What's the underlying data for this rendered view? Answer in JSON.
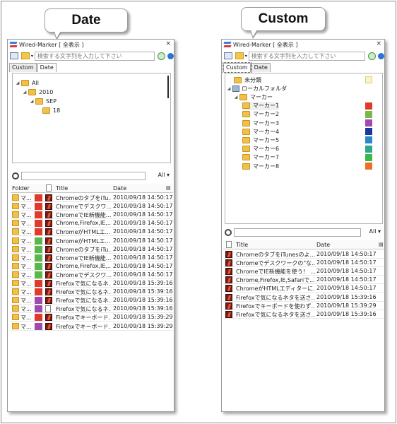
{
  "callouts": {
    "left": "Date",
    "right": "Custom"
  },
  "left_panel": {
    "title": "Wired-Marker [ 全表示 ]",
    "close": "×",
    "search_placeholder": "検索する文字列を入力して下さい",
    "tabs": [
      "Custom",
      "Date"
    ],
    "active_tab": "Date",
    "tree": [
      {
        "label": "All",
        "expanded": true
      },
      {
        "label": "2010",
        "expanded": true
      },
      {
        "label": "SEP",
        "expanded": true
      },
      {
        "label": "18",
        "expanded": false
      }
    ],
    "filter_all": "All",
    "columns": {
      "folder": "Folder",
      "title": "Title",
      "date": "Date"
    },
    "rows": [
      {
        "folder": "マ...",
        "color": "#e03a2a",
        "icon": "firefox",
        "title": "ChromeのタブをiTu...",
        "date": "2010/09/18 14:50:17"
      },
      {
        "folder": "マ...",
        "color": "#e03a2a",
        "icon": "firefox",
        "title": "Chromeでデスクワ...",
        "date": "2010/09/18 14:50:17"
      },
      {
        "folder": "マ...",
        "color": "#e03a2a",
        "icon": "firefox",
        "title": "ChromeでIE新機能...",
        "date": "2010/09/18 14:50:17"
      },
      {
        "folder": "マ...",
        "color": "#e03a2a",
        "icon": "firefox",
        "title": "Chrome,Firefox,IE,...",
        "date": "2010/09/18 14:50:17"
      },
      {
        "folder": "マ...",
        "color": "#e03a2a",
        "icon": "firefox",
        "title": "ChromeがHTMLエ...",
        "date": "2010/09/18 14:50:17"
      },
      {
        "folder": "マ...",
        "color": "#5ab84a",
        "icon": "firefox",
        "title": "ChromeがHTMLエ...",
        "date": "2010/09/18 14:50:17"
      },
      {
        "folder": "マ...",
        "color": "#5ab84a",
        "icon": "firefox",
        "title": "ChromeのタブをiTu...",
        "date": "2010/09/18 14:50:17"
      },
      {
        "folder": "マ...",
        "color": "#5ab84a",
        "icon": "firefox",
        "title": "ChromeでIE新機能...",
        "date": "2010/09/18 14:50:17"
      },
      {
        "folder": "マ...",
        "color": "#5ab84a",
        "icon": "firefox",
        "title": "Chrome,Firefox,IE,...",
        "date": "2010/09/18 14:50:17"
      },
      {
        "folder": "マ...",
        "color": "#5ab84a",
        "icon": "firefox",
        "title": "Chromeでデスクワ...",
        "date": "2010/09/18 14:50:17"
      },
      {
        "folder": "マ...",
        "color": "#e03a2a",
        "icon": "firefox",
        "title": "Firefoxで気になるネ...",
        "date": "2010/09/18 15:39:16"
      },
      {
        "folder": "マ...",
        "color": "#e03a2a",
        "icon": "firefox",
        "title": "Firefoxで気になるネ...",
        "date": "2010/09/18 15:39:16"
      },
      {
        "folder": "マ...",
        "color": "#a04ab0",
        "icon": "firefox",
        "title": "Firefoxで気になるネ...",
        "date": "2010/09/18 15:39:16"
      },
      {
        "folder": "マ...",
        "color": "#a04ab0",
        "icon": "doc",
        "title": "Firefoxで気になるネ...",
        "date": "2010/09/18 15:39:16"
      },
      {
        "folder": "マ...",
        "color": "#e03a2a",
        "icon": "firefox",
        "title": "Firefoxでキーボード...",
        "date": "2010/09/18 15:39:29"
      },
      {
        "folder": "マ...",
        "color": "#a04ab0",
        "icon": "firefox",
        "title": "Firefoxでキーボード...",
        "date": "2010/09/18 15:39:29"
      }
    ]
  },
  "right_panel": {
    "title": "Wired-Marker [ 全表示 ]",
    "close": "×",
    "search_placeholder": "検索する文字列を入力して下さい",
    "tabs": [
      "Custom",
      "Date"
    ],
    "active_tab": "Custom",
    "tree": [
      {
        "label": "未分類",
        "color": "#fdf5b8"
      },
      {
        "label": "ローカルフォルダ",
        "color": ""
      },
      {
        "label": "マーカー",
        "color": ""
      },
      {
        "label": "マーカー1",
        "color": "#e03a2a"
      },
      {
        "label": "マーカー2",
        "color": "#7ab84a"
      },
      {
        "label": "マーカー3",
        "color": "#a04ab0"
      },
      {
        "label": "マーカー4",
        "color": "#1a3a9a"
      },
      {
        "label": "マーカー5",
        "color": "#2a88c8"
      },
      {
        "label": "マーカー6",
        "color": "#2aa890"
      },
      {
        "label": "マーカー7",
        "color": "#3ab84a"
      },
      {
        "label": "マーカー8",
        "color": "#e8702a"
      }
    ],
    "filter_all": "All",
    "columns": {
      "title": "Title",
      "date": "Date"
    },
    "rows": [
      {
        "title": "ChromeのタブをiTunesのよ...",
        "date": "2010/09/18 14:50:17"
      },
      {
        "title": "Chromeでデスクワークの\"な...",
        "date": "2010/09/18 14:50:17"
      },
      {
        "title": "ChromeでIE新機能を使う！ ...",
        "date": "2010/09/18 14:50:17"
      },
      {
        "title": "Chrome,Firefox,IE,Safariで...",
        "date": "2010/09/18 14:50:17"
      },
      {
        "title": "ChromeがHTMLエディターに...",
        "date": "2010/09/18 14:50:17"
      },
      {
        "title": "Firefoxで気になるネタを送さ...",
        "date": "2010/09/18 15:39:16"
      },
      {
        "title": "Firefoxでキーボードを使わず...",
        "date": "2010/09/18 15:39:29"
      },
      {
        "title": "Firefoxで気になるネタを送さ...",
        "date": "2010/09/18 15:39:16"
      }
    ]
  }
}
